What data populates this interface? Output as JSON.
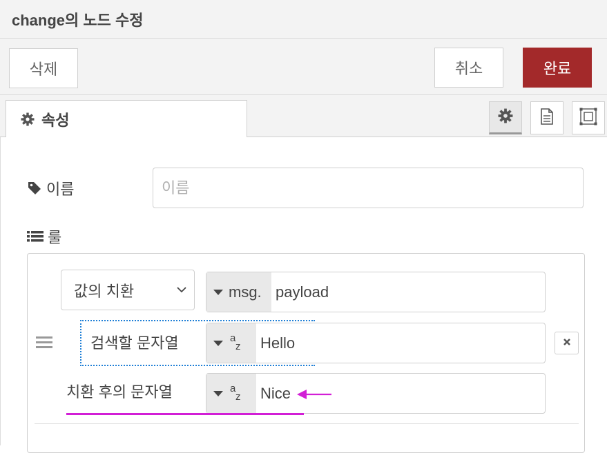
{
  "header": {
    "title": "change의 노드 수정"
  },
  "toolbar": {
    "delete_label": "삭제",
    "cancel_label": "취소",
    "done_label": "완료"
  },
  "tabs": {
    "properties_label": "속성"
  },
  "tab_icons": [
    "gear-icon",
    "document-icon",
    "frame-icon"
  ],
  "form": {
    "name_label": "이름",
    "name_placeholder": "이름",
    "name_value": "",
    "rules_label": "룰"
  },
  "rule": {
    "action": "값의 치환",
    "property_type": "msg.",
    "property_value": "payload",
    "search_label": "검색할 문자열",
    "search_type": "az",
    "search_value": "Hello",
    "replace_label": "치환 후의 문자열",
    "replace_type": "az",
    "replace_value": "Nice"
  },
  "colors": {
    "done_button": "#a3292a",
    "focus_outline": "#1f7fd6",
    "annotation": "#d21fd6"
  }
}
